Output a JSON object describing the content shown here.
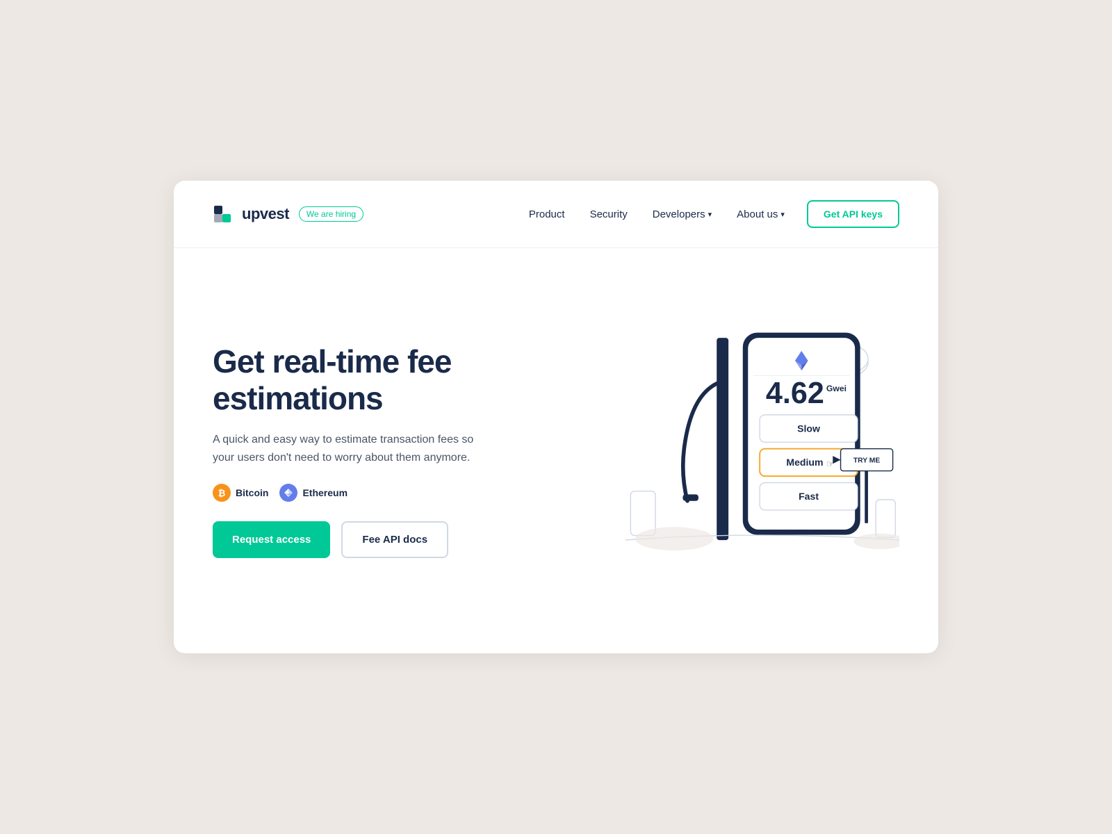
{
  "navbar": {
    "logo_text": "upvest",
    "hiring_label": "We are hiring",
    "links": [
      {
        "label": "Product",
        "has_dropdown": false
      },
      {
        "label": "Security",
        "has_dropdown": false
      },
      {
        "label": "Developers",
        "has_dropdown": true
      },
      {
        "label": "About us",
        "has_dropdown": true
      }
    ],
    "cta_label": "Get API keys"
  },
  "hero": {
    "title": "Get real-time fee estimations",
    "description": "A quick and easy way to estimate transaction fees so your users don't need to worry about them anymore.",
    "coins": [
      {
        "name": "Bitcoin",
        "symbol": "₿"
      },
      {
        "name": "Ethereum",
        "symbol": "◆"
      }
    ],
    "buttons": [
      {
        "label": "Request access",
        "type": "primary"
      },
      {
        "label": "Fee API docs",
        "type": "secondary"
      }
    ]
  },
  "fee_widget": {
    "value": "4.62",
    "unit": "Gwei",
    "options": [
      {
        "label": "Slow",
        "selected": false
      },
      {
        "label": "Medium",
        "selected": true
      },
      {
        "label": "Fast",
        "selected": false
      }
    ],
    "try_me": "TRY ME",
    "eth_symbol": "◆"
  },
  "colors": {
    "teal": "#00c896",
    "dark_navy": "#1a2a4a",
    "orange_selected": "#f5a623",
    "btc_orange": "#f7931a",
    "eth_blue": "#627eea"
  }
}
